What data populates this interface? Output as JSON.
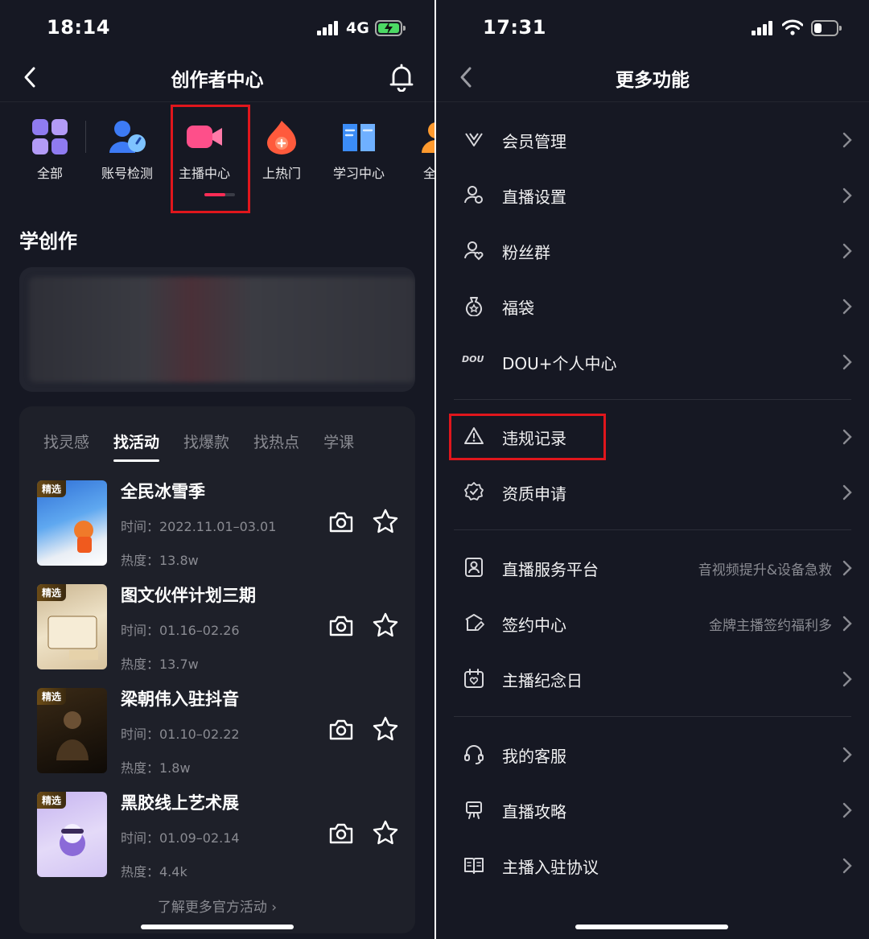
{
  "left": {
    "status": {
      "time": "18:14",
      "network": "4G",
      "battery_color": "#4cd964"
    },
    "nav": {
      "title": "创作者中心"
    },
    "quick_items": [
      {
        "label": "全部",
        "icon": "grid-icon"
      },
      {
        "label": "账号检测",
        "icon": "account-check-icon"
      },
      {
        "label": "主播中心",
        "icon": "camera-icon"
      },
      {
        "label": "上热门",
        "icon": "fire-icon"
      },
      {
        "label": "学习中心",
        "icon": "book-icon"
      },
      {
        "label": "全民",
        "icon": "person-icon"
      }
    ],
    "section_title": "学创作",
    "tabs": [
      "找灵感",
      "找活动",
      "找爆款",
      "找热点",
      "学课"
    ],
    "active_tab": "找活动",
    "activities": [
      {
        "tag": "精选",
        "title": "全民冰雪季",
        "time": "时间：2022.11.01–03.01",
        "heat": "热度：13.8w"
      },
      {
        "tag": "精选",
        "title": "图文伙伴计划三期",
        "time": "时间：01.16–02.26",
        "heat": "热度：13.7w"
      },
      {
        "tag": "精选",
        "title": "梁朝伟入驻抖音",
        "time": "时间：01.10–02.22",
        "heat": "热度：1.8w"
      },
      {
        "tag": "精选",
        "title": "黑胶线上艺术展",
        "time": "时间：01.09–02.14",
        "heat": "热度：4.4k"
      }
    ],
    "more_link": "了解更多官方活动 ›"
  },
  "right": {
    "status": {
      "time": "17:31"
    },
    "nav": {
      "title": "更多功能"
    },
    "rows": [
      {
        "label": "会员管理",
        "icon": "vip-icon",
        "sub": ""
      },
      {
        "label": "直播设置",
        "icon": "live-settings-icon",
        "sub": ""
      },
      {
        "label": "粉丝群",
        "icon": "fan-group-icon",
        "sub": ""
      },
      {
        "label": "福袋",
        "icon": "lucky-bag-icon",
        "sub": ""
      },
      {
        "label": "DOU+个人中心",
        "icon": "dou-icon",
        "sub": ""
      },
      {
        "label": "违规记录",
        "icon": "warning-icon",
        "sub": ""
      },
      {
        "label": "资质申请",
        "icon": "qualification-icon",
        "sub": ""
      },
      {
        "label": "直播服务平台",
        "icon": "service-platform-icon",
        "sub": "音视频提升&设备急救"
      },
      {
        "label": "签约中心",
        "icon": "contract-icon",
        "sub": "金牌主播签约福利多"
      },
      {
        "label": "主播纪念日",
        "icon": "calendar-icon",
        "sub": ""
      },
      {
        "label": "我的客服",
        "icon": "headset-icon",
        "sub": ""
      },
      {
        "label": "直播攻略",
        "icon": "guide-icon",
        "sub": ""
      },
      {
        "label": "主播入驻协议",
        "icon": "agreement-icon",
        "sub": ""
      }
    ],
    "dou_logo_text": "DOU"
  },
  "colors": {
    "background": "#161823",
    "highlight": "#e0161c",
    "accent": "#fe2c55"
  }
}
